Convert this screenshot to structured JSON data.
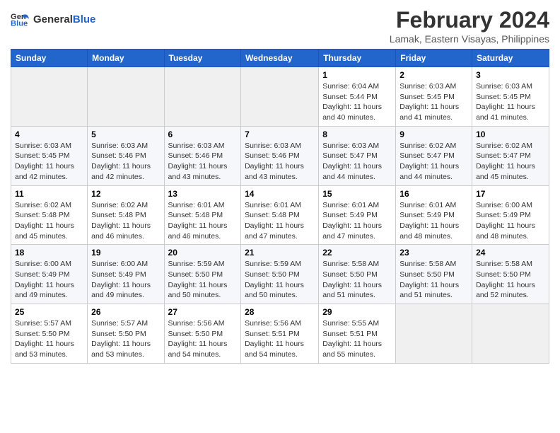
{
  "header": {
    "logo_general": "General",
    "logo_blue": "Blue",
    "month_title": "February 2024",
    "subtitle": "Lamak, Eastern Visayas, Philippines"
  },
  "days_of_week": [
    "Sunday",
    "Monday",
    "Tuesday",
    "Wednesday",
    "Thursday",
    "Friday",
    "Saturday"
  ],
  "weeks": [
    [
      {
        "day": "",
        "info": ""
      },
      {
        "day": "",
        "info": ""
      },
      {
        "day": "",
        "info": ""
      },
      {
        "day": "",
        "info": ""
      },
      {
        "day": "1",
        "info": "Sunrise: 6:04 AM\nSunset: 5:44 PM\nDaylight: 11 hours and 40 minutes."
      },
      {
        "day": "2",
        "info": "Sunrise: 6:03 AM\nSunset: 5:45 PM\nDaylight: 11 hours and 41 minutes."
      },
      {
        "day": "3",
        "info": "Sunrise: 6:03 AM\nSunset: 5:45 PM\nDaylight: 11 hours and 41 minutes."
      }
    ],
    [
      {
        "day": "4",
        "info": "Sunrise: 6:03 AM\nSunset: 5:45 PM\nDaylight: 11 hours and 42 minutes."
      },
      {
        "day": "5",
        "info": "Sunrise: 6:03 AM\nSunset: 5:46 PM\nDaylight: 11 hours and 42 minutes."
      },
      {
        "day": "6",
        "info": "Sunrise: 6:03 AM\nSunset: 5:46 PM\nDaylight: 11 hours and 43 minutes."
      },
      {
        "day": "7",
        "info": "Sunrise: 6:03 AM\nSunset: 5:46 PM\nDaylight: 11 hours and 43 minutes."
      },
      {
        "day": "8",
        "info": "Sunrise: 6:03 AM\nSunset: 5:47 PM\nDaylight: 11 hours and 44 minutes."
      },
      {
        "day": "9",
        "info": "Sunrise: 6:02 AM\nSunset: 5:47 PM\nDaylight: 11 hours and 44 minutes."
      },
      {
        "day": "10",
        "info": "Sunrise: 6:02 AM\nSunset: 5:47 PM\nDaylight: 11 hours and 45 minutes."
      }
    ],
    [
      {
        "day": "11",
        "info": "Sunrise: 6:02 AM\nSunset: 5:48 PM\nDaylight: 11 hours and 45 minutes."
      },
      {
        "day": "12",
        "info": "Sunrise: 6:02 AM\nSunset: 5:48 PM\nDaylight: 11 hours and 46 minutes."
      },
      {
        "day": "13",
        "info": "Sunrise: 6:01 AM\nSunset: 5:48 PM\nDaylight: 11 hours and 46 minutes."
      },
      {
        "day": "14",
        "info": "Sunrise: 6:01 AM\nSunset: 5:48 PM\nDaylight: 11 hours and 47 minutes."
      },
      {
        "day": "15",
        "info": "Sunrise: 6:01 AM\nSunset: 5:49 PM\nDaylight: 11 hours and 47 minutes."
      },
      {
        "day": "16",
        "info": "Sunrise: 6:01 AM\nSunset: 5:49 PM\nDaylight: 11 hours and 48 minutes."
      },
      {
        "day": "17",
        "info": "Sunrise: 6:00 AM\nSunset: 5:49 PM\nDaylight: 11 hours and 48 minutes."
      }
    ],
    [
      {
        "day": "18",
        "info": "Sunrise: 6:00 AM\nSunset: 5:49 PM\nDaylight: 11 hours and 49 minutes."
      },
      {
        "day": "19",
        "info": "Sunrise: 6:00 AM\nSunset: 5:49 PM\nDaylight: 11 hours and 49 minutes."
      },
      {
        "day": "20",
        "info": "Sunrise: 5:59 AM\nSunset: 5:50 PM\nDaylight: 11 hours and 50 minutes."
      },
      {
        "day": "21",
        "info": "Sunrise: 5:59 AM\nSunset: 5:50 PM\nDaylight: 11 hours and 50 minutes."
      },
      {
        "day": "22",
        "info": "Sunrise: 5:58 AM\nSunset: 5:50 PM\nDaylight: 11 hours and 51 minutes."
      },
      {
        "day": "23",
        "info": "Sunrise: 5:58 AM\nSunset: 5:50 PM\nDaylight: 11 hours and 51 minutes."
      },
      {
        "day": "24",
        "info": "Sunrise: 5:58 AM\nSunset: 5:50 PM\nDaylight: 11 hours and 52 minutes."
      }
    ],
    [
      {
        "day": "25",
        "info": "Sunrise: 5:57 AM\nSunset: 5:50 PM\nDaylight: 11 hours and 53 minutes."
      },
      {
        "day": "26",
        "info": "Sunrise: 5:57 AM\nSunset: 5:50 PM\nDaylight: 11 hours and 53 minutes."
      },
      {
        "day": "27",
        "info": "Sunrise: 5:56 AM\nSunset: 5:50 PM\nDaylight: 11 hours and 54 minutes."
      },
      {
        "day": "28",
        "info": "Sunrise: 5:56 AM\nSunset: 5:51 PM\nDaylight: 11 hours and 54 minutes."
      },
      {
        "day": "29",
        "info": "Sunrise: 5:55 AM\nSunset: 5:51 PM\nDaylight: 11 hours and 55 minutes."
      },
      {
        "day": "",
        "info": ""
      },
      {
        "day": "",
        "info": ""
      }
    ]
  ]
}
